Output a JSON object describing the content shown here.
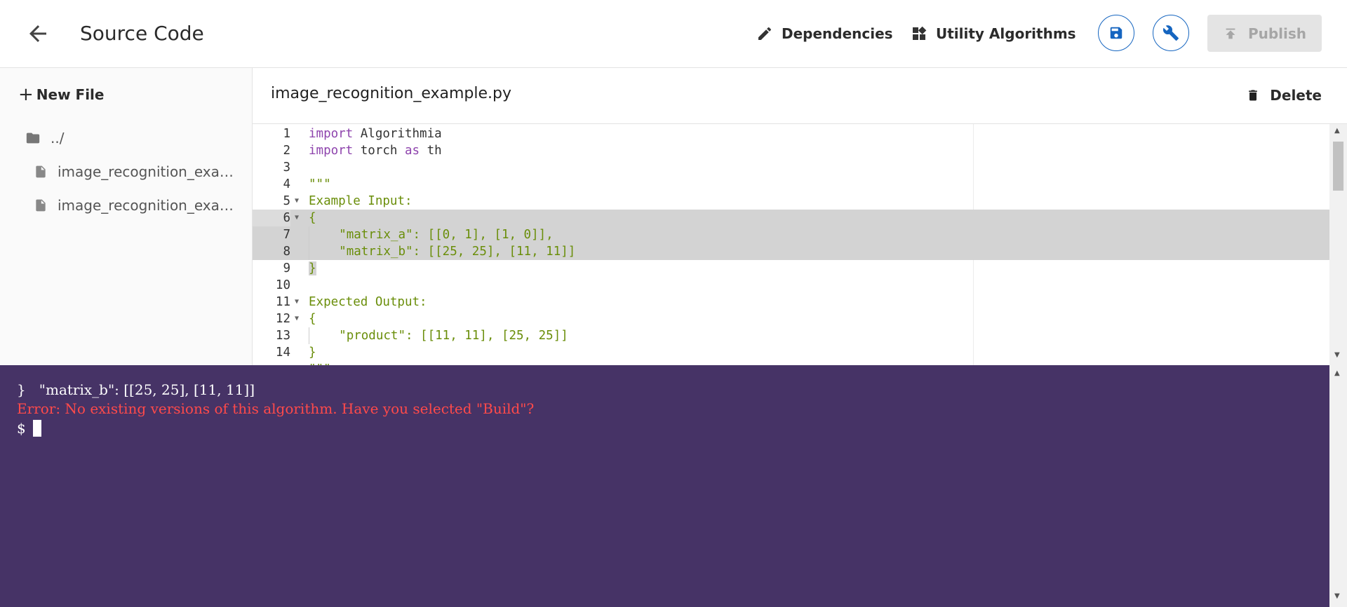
{
  "header": {
    "title": "Source Code",
    "dependencies_label": "Dependencies",
    "utility_label": "Utility Algorithms",
    "publish_label": "Publish"
  },
  "sidebar": {
    "new_file_label": "New File",
    "parent_dir": "../",
    "files": [
      "image_recognition_example.py",
      "image_recognition_example_test.py"
    ]
  },
  "editor": {
    "file_name": "image_recognition_example.py",
    "delete_label": "Delete",
    "line_numbers": [
      "1",
      "2",
      "3",
      "4",
      "5",
      "6",
      "7",
      "8",
      "9",
      "10",
      "11",
      "12",
      "13",
      "14"
    ],
    "lines": {
      "l1_kw": "import",
      "l1_rest": " Algorithmia",
      "l2_kw1": "import",
      "l2_mid": " torch ",
      "l2_kw2": "as",
      "l2_rest": " th",
      "l4": "\"\"\"",
      "l5": "Example Input:",
      "l6": "{",
      "l7": "\"matrix_a\": [[0, 1], [1, 0]],",
      "l8": "\"matrix_b\": [[25, 25], [11, 11]]",
      "l9": "}",
      "l11": "Expected Output:",
      "l12": "{",
      "l13": "\"product\": [[11, 11], [25, 25]]",
      "l14": "}",
      "l15": "\"\"\""
    }
  },
  "terminal": {
    "output_line": "}   \"matrix_b\": [[25, 25], [11, 11]]",
    "error_line": "Error: No existing versions of this algorithm. Have you selected \"Build\"?",
    "prompt": "$"
  },
  "colors": {
    "accent": "#1565c0",
    "terminal_bg": "#463366",
    "error": "#ff4a4a",
    "keyword": "#8e44ad",
    "string": "#6a8e0a"
  }
}
